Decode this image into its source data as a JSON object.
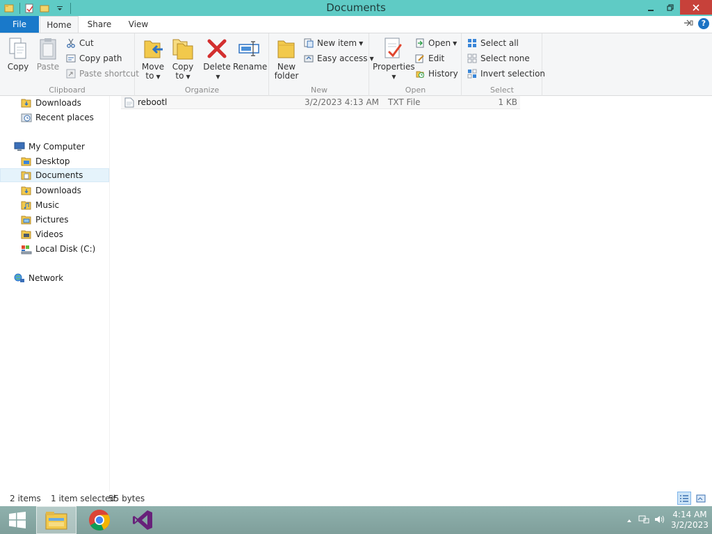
{
  "window": {
    "title": "Documents"
  },
  "tabs": {
    "file": "File",
    "home": "Home",
    "share": "Share",
    "view": "View"
  },
  "ribbon": {
    "clipboard": {
      "label": "Clipboard",
      "copy": "Copy",
      "paste": "Paste",
      "cut": "Cut",
      "copy_path": "Copy path",
      "paste_shortcut": "Paste shortcut"
    },
    "organize": {
      "label": "Organize",
      "move_to_1": "Move",
      "move_to_2": "to",
      "copy_to_1": "Copy",
      "copy_to_2": "to",
      "delete": "Delete",
      "rename": "Rename"
    },
    "new": {
      "label": "New",
      "new_folder_1": "New",
      "new_folder_2": "folder",
      "new_item": "New item",
      "easy_access": "Easy access"
    },
    "open": {
      "label": "Open",
      "properties": "Properties",
      "open": "Open",
      "edit": "Edit",
      "history": "History"
    },
    "select": {
      "label": "Select",
      "select_all": "Select all",
      "select_none": "Select none",
      "invert_selection": "Invert selection"
    }
  },
  "nav": {
    "items": [
      {
        "label": "Downloads"
      },
      {
        "label": "Recent places"
      },
      {
        "label": "My Computer"
      },
      {
        "label": "Desktop"
      },
      {
        "label": "Documents"
      },
      {
        "label": "Downloads"
      },
      {
        "label": "Music"
      },
      {
        "label": "Pictures"
      },
      {
        "label": "Videos"
      },
      {
        "label": "Local Disk (C:)"
      },
      {
        "label": "Network"
      }
    ]
  },
  "files": [
    {
      "name": "rebootl",
      "date": "3/2/2023 4:13 AM",
      "type": "TXT File",
      "size": "1 KB"
    }
  ],
  "status": {
    "items": "2 items",
    "selected": "1 item selected",
    "size": "55 bytes"
  },
  "taskbar": {
    "time": "4:14 AM",
    "date": "3/2/2023"
  },
  "colors": {
    "titlebar": "#5fcbc5",
    "file_tab": "#1979ca",
    "close": "#c7413a",
    "taskbar": "#8fb1ad"
  }
}
